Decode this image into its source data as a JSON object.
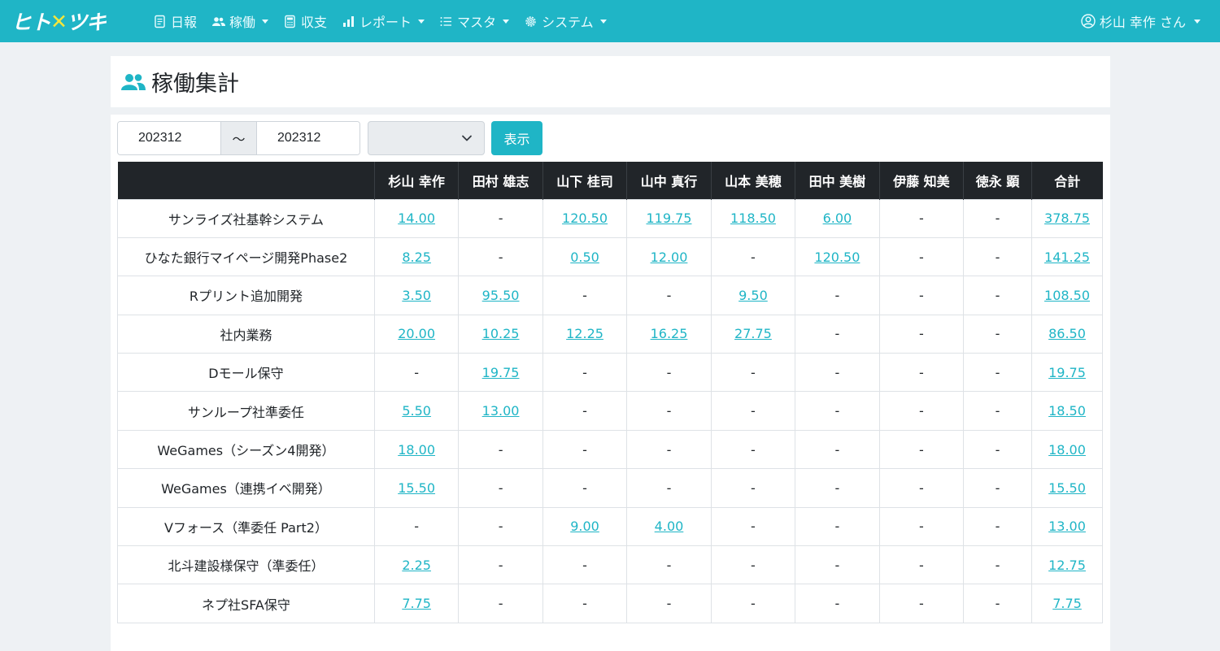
{
  "navbar": {
    "brand": "ヒトツキ",
    "items": [
      {
        "label": "日報",
        "icon": "document-icon",
        "dropdown": false
      },
      {
        "label": "稼働",
        "icon": "users-icon",
        "dropdown": true
      },
      {
        "label": "収支",
        "icon": "calculator-icon",
        "dropdown": false
      },
      {
        "label": "レポート",
        "icon": "bar-chart-icon",
        "dropdown": true
      },
      {
        "label": "マスタ",
        "icon": "list-icon",
        "dropdown": true
      },
      {
        "label": "システム",
        "icon": "gear-icon",
        "dropdown": true
      }
    ],
    "user": "杉山 幸作 さん"
  },
  "page": {
    "title": "稼働集計"
  },
  "filters": {
    "from": "202312",
    "separator": "〜",
    "to": "202312",
    "select_value": "",
    "show_button": "表示"
  },
  "table": {
    "headers": [
      "",
      "杉山 幸作",
      "田村 雄志",
      "山下 桂司",
      "山中 真行",
      "山本 美穂",
      "田中 美樹",
      "伊藤 知美",
      "徳永 顕",
      "合計"
    ],
    "rows": [
      {
        "project": "サンライズ社基幹システム",
        "cells": [
          "14.00",
          "-",
          "120.50",
          "119.75",
          "118.50",
          "6.00",
          "-",
          "-",
          "378.75"
        ]
      },
      {
        "project": "ひなた銀行マイページ開発Phase2",
        "cells": [
          "8.25",
          "-",
          "0.50",
          "12.00",
          "-",
          "120.50",
          "-",
          "-",
          "141.25"
        ]
      },
      {
        "project": "Rプリント追加開発",
        "cells": [
          "3.50",
          "95.50",
          "-",
          "-",
          "9.50",
          "-",
          "-",
          "-",
          "108.50"
        ]
      },
      {
        "project": "社内業務",
        "cells": [
          "20.00",
          "10.25",
          "12.25",
          "16.25",
          "27.75",
          "-",
          "-",
          "-",
          "86.50"
        ]
      },
      {
        "project": "Dモール保守",
        "cells": [
          "-",
          "19.75",
          "-",
          "-",
          "-",
          "-",
          "-",
          "-",
          "19.75"
        ]
      },
      {
        "project": "サンループ社準委任",
        "cells": [
          "5.50",
          "13.00",
          "-",
          "-",
          "-",
          "-",
          "-",
          "-",
          "18.50"
        ]
      },
      {
        "project": "WeGames（シーズン4開発）",
        "cells": [
          "18.00",
          "-",
          "-",
          "-",
          "-",
          "-",
          "-",
          "-",
          "18.00"
        ]
      },
      {
        "project": "WeGames（連携イベ開発）",
        "cells": [
          "15.50",
          "-",
          "-",
          "-",
          "-",
          "-",
          "-",
          "-",
          "15.50"
        ]
      },
      {
        "project": "Vフォース（準委任 Part2）",
        "cells": [
          "-",
          "-",
          "9.00",
          "4.00",
          "-",
          "-",
          "-",
          "-",
          "13.00"
        ]
      },
      {
        "project": "北斗建設様保守（準委任）",
        "cells": [
          "2.25",
          "-",
          "-",
          "-",
          "-",
          "-",
          "-",
          "-",
          "12.75"
        ]
      },
      {
        "project": "ネプ社SFA保守",
        "cells": [
          "7.75",
          "-",
          "-",
          "-",
          "-",
          "-",
          "-",
          "-",
          "7.75"
        ]
      }
    ]
  },
  "colors": {
    "accent": "#1fb5c6",
    "header_bg": "#212529",
    "page_bg": "#eef1f4"
  }
}
